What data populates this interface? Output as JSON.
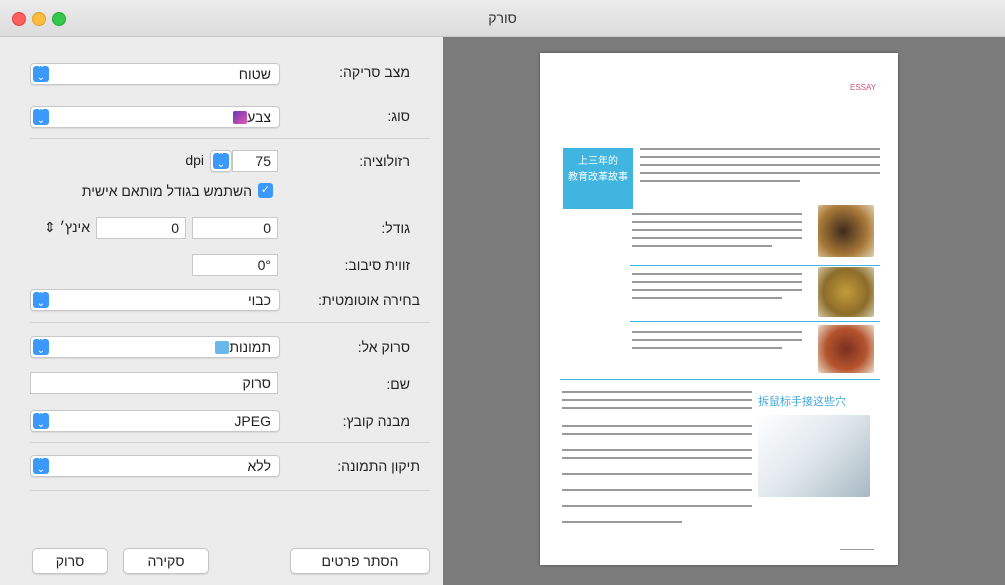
{
  "window": {
    "title": "סורק"
  },
  "form": {
    "scan_mode": {
      "label": "מצב סריקה:",
      "value": "שטוח"
    },
    "kind": {
      "label": "סוג:",
      "value": "צבע"
    },
    "resolution": {
      "label": "רזולוציה:",
      "value": "75",
      "unit": "dpi"
    },
    "custom_size": {
      "label": "השתמש בגודל מותאם אישית",
      "checked": true
    },
    "size": {
      "label": "גודל:",
      "width": "0",
      "height": "0",
      "unit": "אינץ׳"
    },
    "rotation": {
      "label": "זווית סיבוב:",
      "value": "0°"
    },
    "auto_select": {
      "label": "בחירה אוטומטית:",
      "value": "כבוי"
    },
    "scan_to": {
      "label": "סרוק אל:",
      "value": "תמונות"
    },
    "name": {
      "label": "שם:",
      "value": "סרוק"
    },
    "format": {
      "label": "מבנה קובץ:",
      "value": "JPEG"
    },
    "correction": {
      "label": "תיקון התמונה:",
      "value": "ללא"
    }
  },
  "buttons": {
    "hide_details": "הסתר פרטים",
    "overview": "סקירה",
    "scan": "סרוק"
  },
  "preview": {
    "header_tag": "ESSAY",
    "blue_box_line1": "上三年的",
    "blue_box_line2": "教育改革故事",
    "caption": "拆鼠标手接这些穴"
  },
  "colors": {
    "accent": "#3b99fc",
    "preview_bg": "#7c7c7c"
  }
}
